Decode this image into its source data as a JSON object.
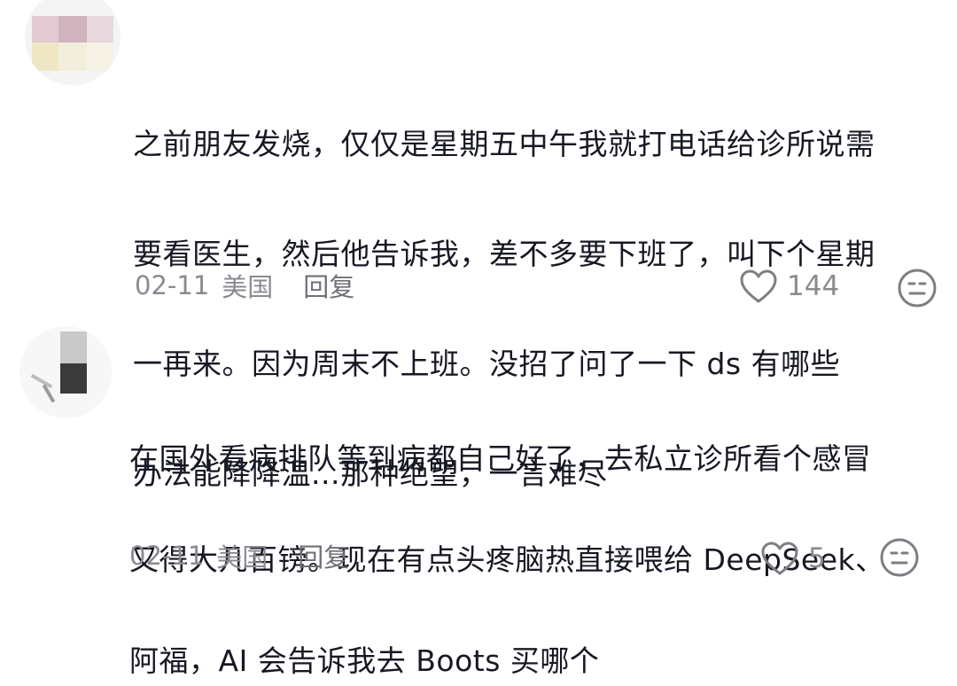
{
  "comments": [
    {
      "text_lines": [
        "之前朋友发烧，仅仅是星期五中午我就打电话给诊所说需",
        "要看医生，然后他告诉我，差不多要下班了，叫下个星期",
        "一再来。因为周末不上班。没招了问了一下 ds 有哪些",
        "办法能降降温...那种绝望，一言难尽"
      ],
      "date": "02-11",
      "location": "美国",
      "reply_label": "回复",
      "likes": "144",
      "like_icon": "heart-outline-icon",
      "dislike_icon": "neutral-face-icon"
    },
    {
      "text_lines": [
        "在国外看病排队等到病都自己好了，去私立诊所看个感冒",
        "又得大几百镑。现在有点头疼脑热直接喂给 DeepSeek、",
        "阿福，AI 会告诉我去 Boots 买哪个"
      ],
      "date": "02-11",
      "location": "美国",
      "reply_label": "回复",
      "likes": "5",
      "like_icon": "heart-outline-icon",
      "dislike_icon": "neutral-face-icon"
    }
  ],
  "colors": {
    "text_primary": "#161823",
    "text_secondary": "#8a8b91",
    "icon_gray": "#7d7e84"
  }
}
